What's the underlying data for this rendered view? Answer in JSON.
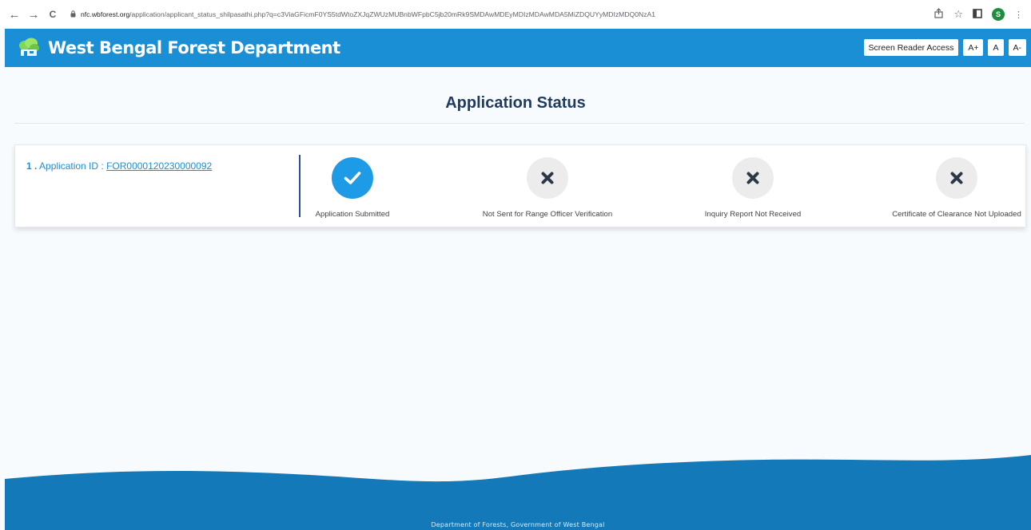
{
  "browser": {
    "back": "←",
    "forward": "→",
    "reload": "C",
    "url_host": "nfc.wbforest.org",
    "url_path": "/application/applicant_status_shilpasathi.php?q=c3ViaGFicmF0YS5tdWtoZXJqZWUzMUBnbWFpbC5jb20mRk9SMDAwMDEyMDIzMDAwMDA5MiZDQUYyMDIzMDQ0NzA1",
    "profile_initial": "S",
    "colors": {
      "chrome": "#ffffff"
    }
  },
  "header": {
    "brand": "West Bengal Forest Department",
    "screen_reader": "Screen Reader Access",
    "font_increase": "A+",
    "font_normal": "A",
    "font_decrease": "A-",
    "colors": {
      "header": "#1b8fd6"
    }
  },
  "main": {
    "title": "Application Status",
    "application": {
      "index": "1 .",
      "label": "Application ID :",
      "id": "FOR0000120230000092"
    },
    "steps": [
      {
        "label": "Application Submitted",
        "status": "done",
        "icon": "check-icon"
      },
      {
        "label": "Not Sent for Range Officer Verification",
        "status": "pending",
        "icon": "cross-icon"
      },
      {
        "label": "Inquiry Report Not Received",
        "status": "pending",
        "icon": "cross-icon"
      },
      {
        "label": "Certificate of Clearance Not Uploaded",
        "status": "pending",
        "icon": "cross-icon"
      }
    ]
  },
  "footer": {
    "text": "Department of Forests, Government of West Bengal",
    "colors": {
      "wave": "#1479b8"
    }
  }
}
